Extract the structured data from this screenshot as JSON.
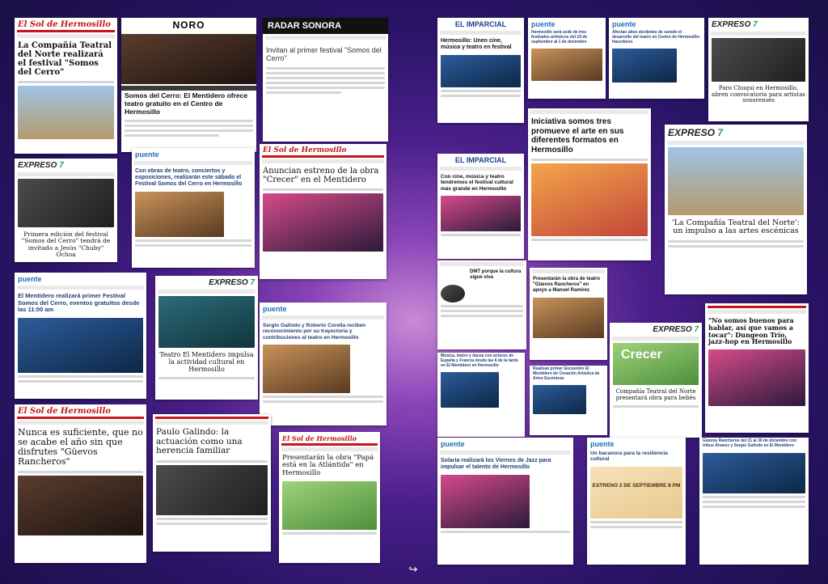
{
  "logos": {
    "sol": "El Sol de Hermosillo",
    "noro": "NORO",
    "radar": "RADAR SONORA",
    "imparcial": "EL IMPARCIAL",
    "expreso": "EXPRESO",
    "puente": "puente"
  },
  "articles": {
    "a1": "La Compañía Teatral del Norte realizará el festival \"Somos del Cerro\"",
    "a2": "Somos del Cerro: El Mentidero ofrece teatro gratuito en el Centro de Hermosillo",
    "a3": "Invitan al primer festival \"Somos del Cerro\"",
    "a4": "Primera edición del festival \"Somos del Cerro\" tendrá de invitado a Jesús \"Chuby\" Ochoa",
    "a5": "Con obras de teatro, conciertos y exposiciones, realizarán este sábado el Festival Somos del Cerro en Hermosillo",
    "a6": "Anuncian estreno de la obra \"Crecer\" en el Mentidero",
    "a7": "El Mentidero realizará primer Festival Somos del Cerro, eventos gratuitos desde las 11:00 am",
    "a8": "Teatro El Mentidero impulsa la actividad cultural en Hermosillo",
    "a9": "Sergio Galindo y Roberto Corella reciben reconocimiento por su trayectoria y contribuciones al teatro en Hermosillo",
    "a10": "Nunca es suficiente, que no se acabe el año sin que disfrutes \"Güevos Rancheros\"",
    "a11": "Paulo Galindo: la actuación como una herencia familiar",
    "a12": "Presentarán la obra \"Papá está en la Atlántida\" en Hermosillo",
    "b1": "Hermosillo: Unen cine, música y teatro en festival",
    "b2": "Hermosillo será sede de tres festivales artísticos del 19 de septiembre al 1 de diciembre",
    "b3": "Afectan altos decibeles de sonido el desarrollo del teatro en Centro de Hermosillo: Hacedores",
    "b4": "Paro Chuqui en Hermosillo, abren convocatoria para artistas sonorenses",
    "b5": "Con cine, música y teatro tendremos el festival cultural más grande en Hermosillo",
    "b6": "Iniciativa somos tres promueve el arte en sus diferentes formatos en Hermosillo",
    "b7": "'La Compañía Teatral del Norte': un impulso a las artes escénicas",
    "b8": "DMT porque la cultura sigue viva",
    "b9": "Presentarán la obra de teatro \"Güevos Rancheros\" en apoyo a Manuel Ramírez",
    "b10": "\"No somos buenos para hablar, así que vamos a tocar\": Dungeon Trío, jazz-hop en Hermosillo",
    "b11": "Música, teatro y danza con actores de España y Francia desde las 6 de la tarde en El Mentidero en Hermosillo",
    "b12": "Realizan primer Encuentro El Mentidero de Creación Artística de Artes Escénicas",
    "b13": "Compañía Teatral del Norte presentará obra para bebés",
    "b14": "Solaria realizará los Viernes de Jazz para impulsar el talento de Hermosillo",
    "b15": "Un bacanora para la resiliencia cultural",
    "b16": "Güevos Rancheros del 21 al 30 de diciembre con tribus Álvarez y Sergio Galindo en El Mentidero",
    "b15_poster": "ESTRENO 2 DE SEPTIEMBRE 8 PM",
    "b13_poster": "Crecer"
  }
}
